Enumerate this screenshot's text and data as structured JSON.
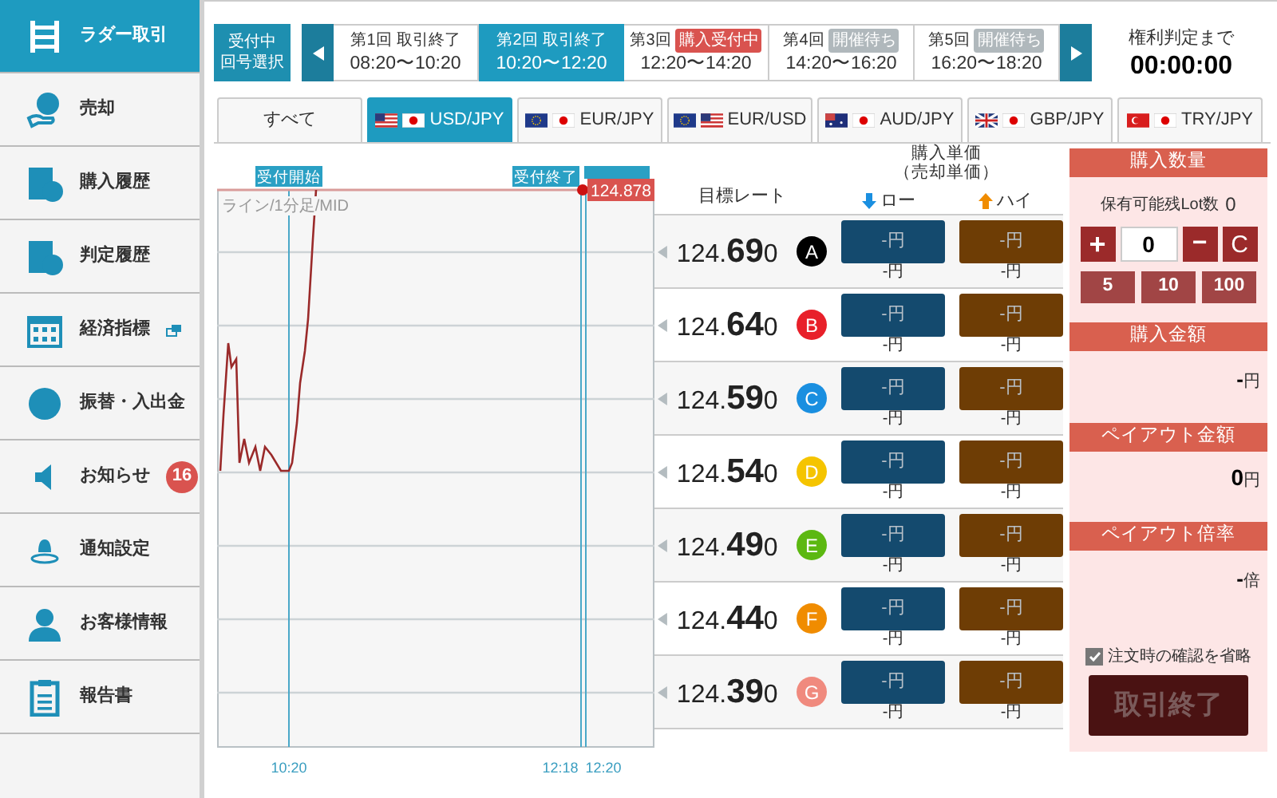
{
  "sidebar": {
    "items": [
      {
        "label": "ラダー取引",
        "selected": true
      },
      {
        "label": "売却",
        "selected": false
      },
      {
        "label": "購入履歴",
        "selected": false
      },
      {
        "label": "判定履歴",
        "selected": false
      },
      {
        "label": "経済指標",
        "selected": false
      },
      {
        "label": "振替・入出金",
        "selected": false
      },
      {
        "label": "お知らせ",
        "selected": false,
        "badge": "16"
      },
      {
        "label": "通知設定",
        "selected": false
      },
      {
        "label": "お客様情報",
        "selected": false
      },
      {
        "label": "報告書",
        "selected": false
      }
    ]
  },
  "session_bar": {
    "select_button": [
      "受付中",
      "回号選択"
    ],
    "sessions": [
      {
        "number": "第1回",
        "status": "取引終了",
        "kind": "plain",
        "time": "08:20〜10:20",
        "selected": false
      },
      {
        "number": "第2回",
        "status": "取引終了",
        "kind": "plain",
        "time": "10:20〜12:20",
        "selected": true
      },
      {
        "number": "第3回",
        "status": "購入受付中",
        "kind": "open",
        "time": "12:20〜14:20",
        "selected": false
      },
      {
        "number": "第4回",
        "status": "開催待ち",
        "kind": "waiting",
        "time": "14:20〜16:20",
        "selected": false
      },
      {
        "number": "第5回",
        "status": "開催待ち",
        "kind": "waiting",
        "time": "16:20〜18:20",
        "selected": false
      }
    ],
    "countdown_label": "権利判定まで",
    "countdown": "00:00:00"
  },
  "tabs": [
    {
      "label": "すべて",
      "selected": false
    },
    {
      "label": "USD/JPY",
      "selected": true
    },
    {
      "label": "EUR/JPY",
      "selected": false
    },
    {
      "label": "EUR/USD",
      "selected": false
    },
    {
      "label": "AUD/JPY",
      "selected": false
    },
    {
      "label": "GBP/JPY",
      "selected": false
    },
    {
      "label": "TRY/JPY",
      "selected": false
    }
  ],
  "chart": {
    "start_label": "受付開始",
    "end_label": "受付終了",
    "chart_type": "ライン/1分足/MID",
    "current_price": "124.878",
    "time_labels": [
      "10:20",
      "12:18",
      "12:20"
    ]
  },
  "ladder": {
    "price_header": [
      "購入単価",
      "（売却単価）"
    ],
    "rate_header": "目標レート",
    "low_header": "ロー",
    "high_header": "ハイ",
    "rows": [
      {
        "rate_prefix": "124.",
        "rate_main": "69",
        "rate_suffix": "0",
        "letter": "A",
        "color": "#000000",
        "low": "-円",
        "low_sub": "-円",
        "high": "-円",
        "high_sub": "-円"
      },
      {
        "rate_prefix": "124.",
        "rate_main": "64",
        "rate_suffix": "0",
        "letter": "B",
        "color": "#e8202a",
        "low": "-円",
        "low_sub": "-円",
        "high": "-円",
        "high_sub": "-円"
      },
      {
        "rate_prefix": "124.",
        "rate_main": "59",
        "rate_suffix": "0",
        "letter": "C",
        "color": "#1a8fe0",
        "low": "-円",
        "low_sub": "-円",
        "high": "-円",
        "high_sub": "-円"
      },
      {
        "rate_prefix": "124.",
        "rate_main": "54",
        "rate_suffix": "0",
        "letter": "D",
        "color": "#f5c400",
        "low": "-円",
        "low_sub": "-円",
        "high": "-円",
        "high_sub": "-円"
      },
      {
        "rate_prefix": "124.",
        "rate_main": "49",
        "rate_suffix": "0",
        "letter": "E",
        "color": "#5cb811",
        "low": "-円",
        "low_sub": "-円",
        "high": "-円",
        "high_sub": "-円"
      },
      {
        "rate_prefix": "124.",
        "rate_main": "44",
        "rate_suffix": "0",
        "letter": "F",
        "color": "#f08c00",
        "low": "-円",
        "low_sub": "-円",
        "high": "-円",
        "high_sub": "-円"
      },
      {
        "rate_prefix": "124.",
        "rate_main": "39",
        "rate_suffix": "0",
        "letter": "G",
        "color": "#f08a7e",
        "low": "-円",
        "low_sub": "-円",
        "high": "-円",
        "high_sub": "-円"
      }
    ]
  },
  "order_panel": {
    "quantity_title": "購入数量",
    "lot_label": "保有可能残Lot数",
    "lot_value": "0",
    "plus": "+",
    "quantity": "0",
    "minus": "−",
    "clear": "C",
    "presets": [
      "5",
      "10",
      "100"
    ],
    "amount_title": "購入金額",
    "amount_value": "-",
    "amount_unit": "円",
    "payout_title": "ペイアウト金額",
    "payout_value": "0",
    "payout_unit": "円",
    "rate_title": "ペイアウト倍率",
    "rate_value": "-",
    "rate_unit": "倍",
    "skip_confirm": {
      "label": "注文時の確認を省略",
      "checked": true
    },
    "submit": {
      "label": "取引終了",
      "disabled": true
    }
  }
}
